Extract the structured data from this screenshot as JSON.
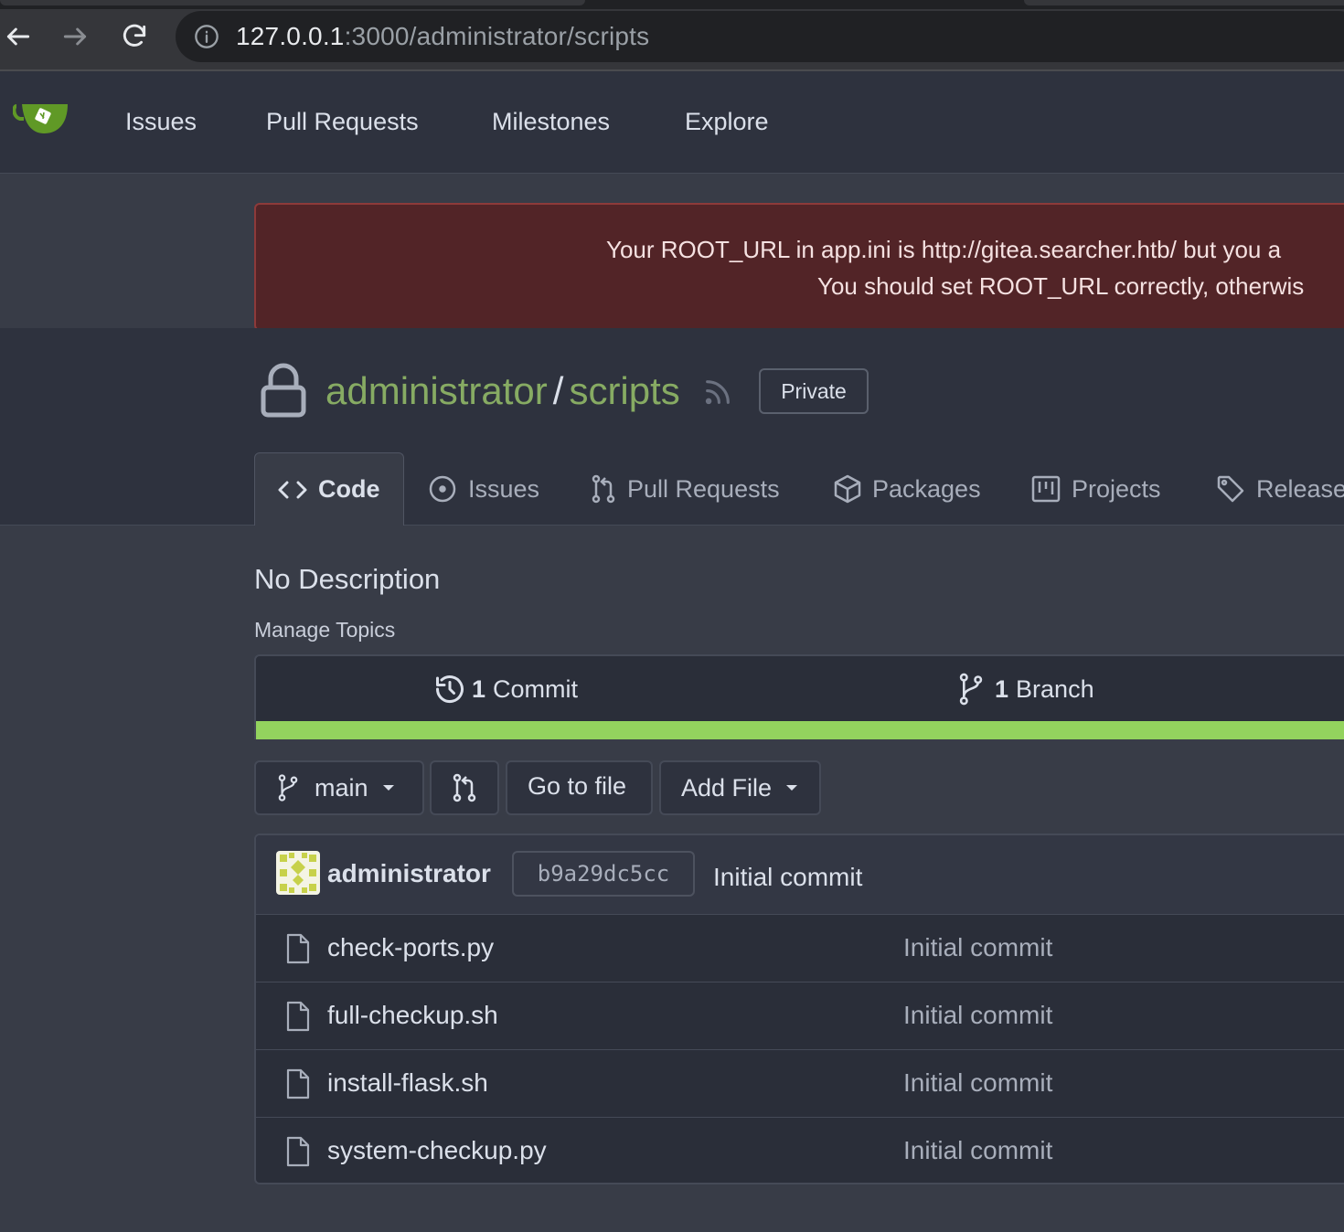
{
  "browser": {
    "url_host": "127.0.0.1",
    "url_rest": ":3000/administrator/scripts"
  },
  "header": {
    "nav": [
      "Issues",
      "Pull Requests",
      "Milestones",
      "Explore"
    ]
  },
  "alert": {
    "line1": "Your ROOT_URL in app.ini is http://gitea.searcher.htb/ but you a",
    "line2": "You should set ROOT_URL correctly, otherwis"
  },
  "repo": {
    "owner": "administrator",
    "separator": "/",
    "name": "scripts",
    "visibility": "Private",
    "tabs": [
      "Code",
      "Issues",
      "Pull Requests",
      "Packages",
      "Projects",
      "Release"
    ],
    "description": "No Description",
    "manage_topics": "Manage Topics",
    "commits_count": "1",
    "commits_label": "Commit",
    "branches_count": "1",
    "branches_label": "Branch"
  },
  "toolbar": {
    "branch": "main",
    "go_to_file": "Go to file",
    "add_file": "Add File"
  },
  "latest_commit": {
    "author": "administrator",
    "sha": "b9a29dc5cc",
    "message": "Initial commit"
  },
  "files": [
    {
      "name": "check-ports.py",
      "message": "Initial commit"
    },
    {
      "name": "full-checkup.sh",
      "message": "Initial commit"
    },
    {
      "name": "install-flask.sh",
      "message": "Initial commit"
    },
    {
      "name": "system-checkup.py",
      "message": "Initial commit"
    }
  ],
  "colors": {
    "accent_green": "#87ab63",
    "language_bar": "#93d35e",
    "alert_bg": "#522427"
  }
}
